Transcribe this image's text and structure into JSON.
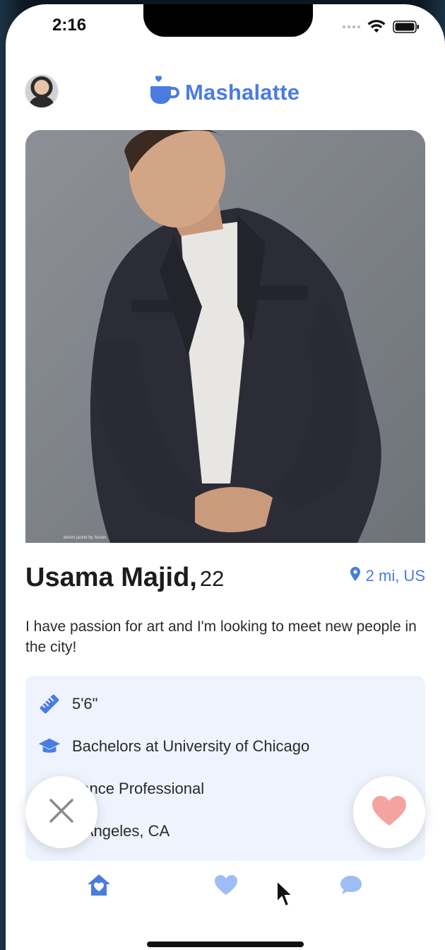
{
  "status_bar": {
    "time": "2:16"
  },
  "header": {
    "brand_name": "Mashalatte",
    "brand_color": "#4a7ce0"
  },
  "photo": {
    "caption": "denim jacket by Seven"
  },
  "profile": {
    "name": "Usama Majid,",
    "age": "22",
    "location": "2 mi, US",
    "bio": "I have passion for art and I'm looking to meet new people in the city!"
  },
  "details": [
    {
      "icon": "ruler-icon",
      "text": "5'6\""
    },
    {
      "icon": "graduation-cap-icon",
      "text": "Bachelors at University of Chicago"
    },
    {
      "icon": "briefcase-icon",
      "text": "nance Professional"
    },
    {
      "icon": "home-pin-icon",
      "text": "s Angeles, CA"
    }
  ],
  "actions": {
    "pass_icon": "close-icon",
    "like_icon": "heart-icon",
    "like_color": "#f4a4a0"
  },
  "tabs": [
    {
      "name": "home",
      "icon": "home-heart-icon",
      "active": true
    },
    {
      "name": "likes",
      "icon": "heart-icon",
      "active": false
    },
    {
      "name": "chat",
      "icon": "chat-bubble-icon",
      "active": false
    }
  ],
  "colors": {
    "accent": "#4a7ce0",
    "accent_light": "#9ebdf5",
    "details_bg": "#eef3fe"
  }
}
